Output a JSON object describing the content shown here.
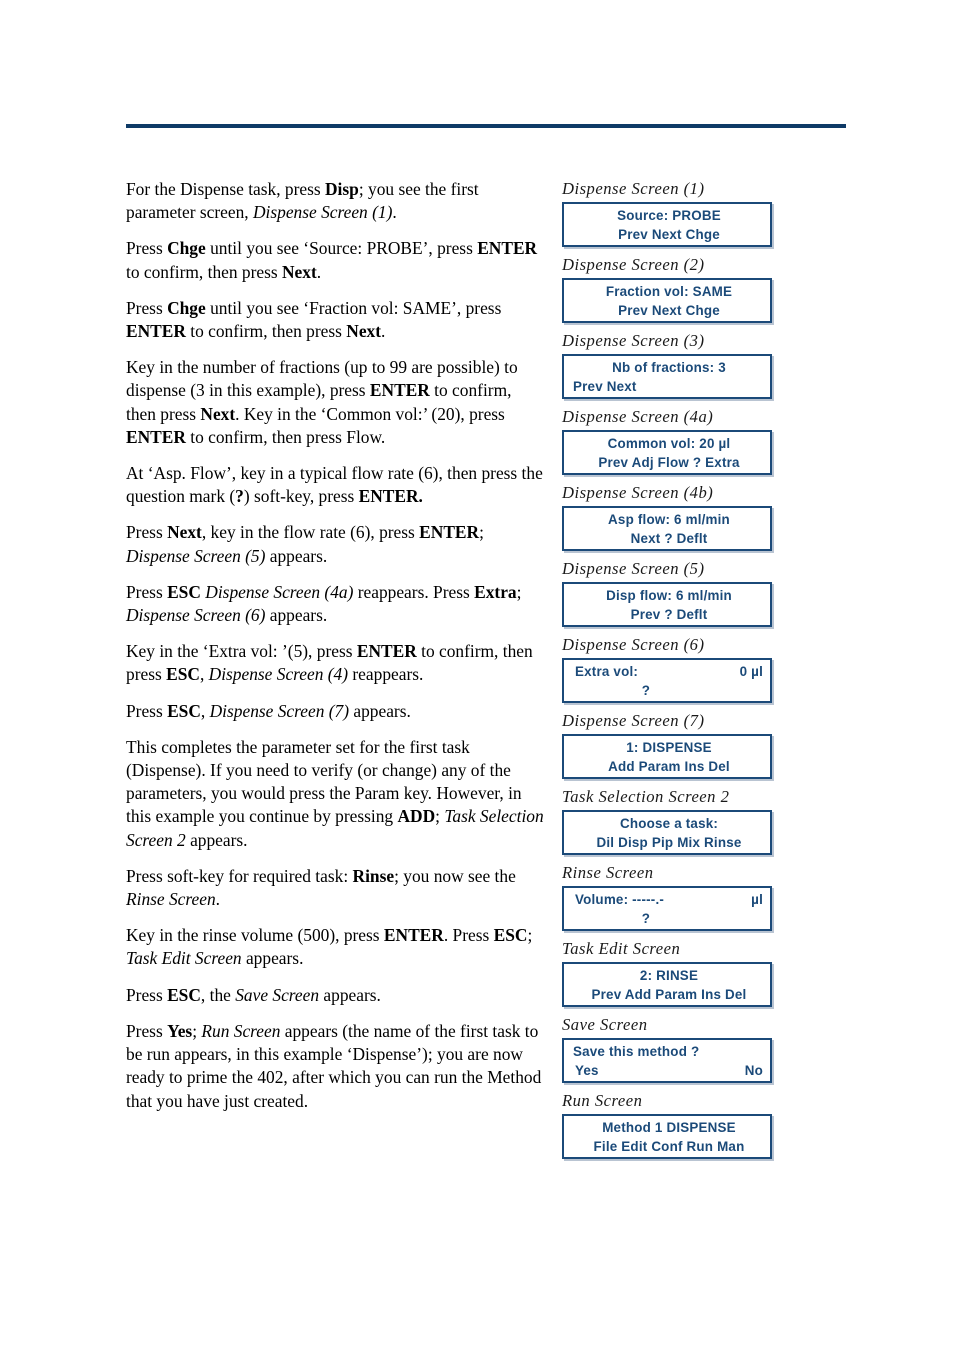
{
  "header": {
    "rule_color": "#0e3a66"
  },
  "colors": {
    "lcd_text": "#1b4a79",
    "lcd_border": "#1b4a79",
    "rule": "#0e3a66"
  },
  "instructions": [
    {
      "id": "p1",
      "segments": [
        {
          "t": "For the Dispense task, press ",
          "s": "n"
        },
        {
          "t": "Disp",
          "s": "b"
        },
        {
          "t": "; you see the first parameter screen, ",
          "s": "n"
        },
        {
          "t": "Dispense Screen (1)",
          "s": "i"
        },
        {
          "t": ".",
          "s": "n"
        }
      ]
    },
    {
      "id": "p2",
      "segments": [
        {
          "t": "Press ",
          "s": "n"
        },
        {
          "t": "Chge",
          "s": "b"
        },
        {
          "t": " until you see ‘Source: PROBE’, press ",
          "s": "n"
        },
        {
          "t": "ENTER",
          "s": "b"
        },
        {
          "t": " to confirm, then press ",
          "s": "n"
        },
        {
          "t": "Next",
          "s": "b"
        },
        {
          "t": ".",
          "s": "n"
        }
      ]
    },
    {
      "id": "p3",
      "segments": [
        {
          "t": "Press ",
          "s": "n"
        },
        {
          "t": "Chge",
          "s": "b"
        },
        {
          "t": " until you see ‘Fraction vol: SAME’, press ",
          "s": "n"
        },
        {
          "t": "ENTER",
          "s": "b"
        },
        {
          "t": " to confirm, then press ",
          "s": "n"
        },
        {
          "t": "Next",
          "s": "b"
        },
        {
          "t": ".",
          "s": "n"
        }
      ]
    },
    {
      "id": "p4",
      "segments": [
        {
          "t": "Key in the number of fractions (up to 99 are possible) to dispense (3 in this example), press ",
          "s": "n"
        },
        {
          "t": "ENTER",
          "s": "b"
        },
        {
          "t": " to confirm, then press ",
          "s": "n"
        },
        {
          "t": "Next",
          "s": "b"
        },
        {
          "t": ". Key in the ‘Common vol:’ (20), press ",
          "s": "n"
        },
        {
          "t": "ENTER",
          "s": "b"
        },
        {
          "t": " to confirm, then press Flow.",
          "s": "n"
        }
      ]
    },
    {
      "id": "p5",
      "segments": [
        {
          "t": "At ‘Asp. Flow’, key in a typical flow rate (6), then press the question mark (",
          "s": "n"
        },
        {
          "t": "?",
          "s": "b"
        },
        {
          "t": ") soft-key, press ",
          "s": "n"
        },
        {
          "t": "ENTER.",
          "s": "b"
        }
      ]
    },
    {
      "id": "p6",
      "segments": [
        {
          "t": "Press ",
          "s": "n"
        },
        {
          "t": "Next",
          "s": "b"
        },
        {
          "t": ", key in the flow rate (6), press ",
          "s": "n"
        },
        {
          "t": "ENTER",
          "s": "b"
        },
        {
          "t": "; ",
          "s": "n"
        },
        {
          "t": "Dispense Screen (5)",
          "s": "i"
        },
        {
          "t": " appears.",
          "s": "n"
        }
      ]
    },
    {
      "id": "p7",
      "segments": [
        {
          "t": "Press ",
          "s": "n"
        },
        {
          "t": "ESC",
          "s": "b"
        },
        {
          "t": " ",
          "s": "n"
        },
        {
          "t": "Dispense Screen (4a)",
          "s": "i"
        },
        {
          "t": " reappears. Press ",
          "s": "n"
        },
        {
          "t": "Extra",
          "s": "b"
        },
        {
          "t": "; ",
          "s": "n"
        },
        {
          "t": "Dispense Screen (6)",
          "s": "i"
        },
        {
          "t": " appears.",
          "s": "n"
        }
      ]
    },
    {
      "id": "p8",
      "segments": [
        {
          "t": "Key in the ‘Extra vol: ’(5), press ",
          "s": "n"
        },
        {
          "t": "ENTER",
          "s": "b"
        },
        {
          "t": " to confirm, then press ",
          "s": "n"
        },
        {
          "t": "ESC",
          "s": "b"
        },
        {
          "t": ", ",
          "s": "n"
        },
        {
          "t": "Dispense Screen (4)",
          "s": "i"
        },
        {
          "t": " reappears.",
          "s": "n"
        }
      ]
    },
    {
      "id": "p9",
      "segments": [
        {
          "t": "Press ",
          "s": "n"
        },
        {
          "t": "ESC",
          "s": "b"
        },
        {
          "t": ", ",
          "s": "n"
        },
        {
          "t": "Dispense Screen (7)",
          "s": "i"
        },
        {
          "t": " appears.",
          "s": "n"
        }
      ]
    },
    {
      "id": "p10",
      "segments": [
        {
          "t": "This completes the parameter set for the first task (Dispense). If you need to verify (or change) any of the parameters, you would press the Param key. However, in this example you continue by pressing ",
          "s": "n"
        },
        {
          "t": "ADD",
          "s": "b"
        },
        {
          "t": "; ",
          "s": "n"
        },
        {
          "t": "Task Selection Screen 2",
          "s": "i"
        },
        {
          "t": " appears.",
          "s": "n"
        }
      ]
    },
    {
      "id": "p11",
      "segments": [
        {
          "t": "Press soft-key for required task: ",
          "s": "n"
        },
        {
          "t": "Rinse",
          "s": "b"
        },
        {
          "t": "; you now see the ",
          "s": "n"
        },
        {
          "t": "Rinse Screen",
          "s": "i"
        },
        {
          "t": ".",
          "s": "n"
        }
      ]
    },
    {
      "id": "p12",
      "segments": [
        {
          "t": "Key in the rinse volume (500), press ",
          "s": "n"
        },
        {
          "t": "ENTER",
          "s": "b"
        },
        {
          "t": ". Press ",
          "s": "n"
        },
        {
          "t": "ESC",
          "s": "b"
        },
        {
          "t": "; ",
          "s": "n"
        },
        {
          "t": "Task Edit Screen",
          "s": "i"
        },
        {
          "t": " appears.",
          "s": "n"
        }
      ]
    },
    {
      "id": "p13",
      "segments": [
        {
          "t": "Press ",
          "s": "n"
        },
        {
          "t": "ESC",
          "s": "b"
        },
        {
          "t": ", the ",
          "s": "n"
        },
        {
          "t": "Save Screen",
          "s": "i"
        },
        {
          "t": " appears.",
          "s": "n"
        }
      ]
    },
    {
      "id": "p14",
      "segments": [
        {
          "t": "Press ",
          "s": "n"
        },
        {
          "t": "Yes",
          "s": "b"
        },
        {
          "t": "; ",
          "s": "n"
        },
        {
          "t": "Run Screen",
          "s": "i"
        },
        {
          "t": " appears (the name of the first task to be run appears, in this example ‘Dispense’); you are now ready to prime the 402, after which you can run the Method that you have just created.",
          "s": "n"
        }
      ]
    }
  ],
  "screens": [
    {
      "caption": "Dispense Screen (1)",
      "layout": "center-center",
      "row1": "Source:   PROBE",
      "row2": "Prev Next     Chge"
    },
    {
      "caption": "Dispense Screen (2)",
      "layout": "center-center",
      "row1": "Fraction vol:  SAME",
      "row2": "Prev Next     Chge"
    },
    {
      "caption": "Dispense Screen (3)",
      "layout": "center-left",
      "row1": "Nb of fractions:   3",
      "row2": "Prev Next"
    },
    {
      "caption": "Dispense Screen (4a)",
      "layout": "center-center",
      "row1": "Common vol:   20   µl",
      "row2": "Prev Adj  Flow  ?   Extra"
    },
    {
      "caption": "Dispense Screen (4b)",
      "layout": "center-center",
      "row1": "Asp  flow:  6      ml/min",
      "row2": "Next            ?   Deflt"
    },
    {
      "caption": "Dispense Screen (5)",
      "layout": "center-center",
      "row1": "Disp flow:  6      ml/min",
      "row2": "Prev            ?   Deflt"
    },
    {
      "caption": "Dispense Screen (6)",
      "layout": "split-qmark",
      "row1_left": "Extra vol:",
      "row1_right": "0  µl",
      "row2": "?"
    },
    {
      "caption": "Dispense Screen (7)",
      "layout": "center-center",
      "row1": "1:  DISPENSE",
      "row2": "Add Param Ins  Del"
    },
    {
      "caption": "Task Selection Screen 2",
      "layout": "center-center",
      "row1": "Choose a task:",
      "row2": "Dil Disp Pip Mix  Rinse"
    },
    {
      "caption": "Rinse Screen",
      "layout": "split-qmark",
      "row1_left": "Volume:   -----.-",
      "row1_right": "µl",
      "row2": "?"
    },
    {
      "caption": "Task Edit Screen",
      "layout": "center-center",
      "row1": "2:  RINSE",
      "row2": "Prev  Add Param Ins  Del"
    },
    {
      "caption": "Save Screen",
      "layout": "split-yesno",
      "row1": "Save this method ?",
      "row2_left": "Yes",
      "row2_right": "No"
    },
    {
      "caption": "Run Screen",
      "layout": "center-center",
      "row1": "Method  1   DISPENSE",
      "row2": "File Edit Conf  Run  Man"
    }
  ]
}
